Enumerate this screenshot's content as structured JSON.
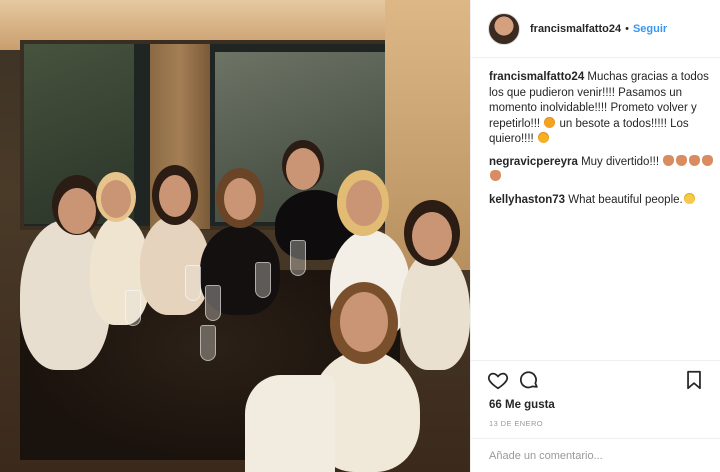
{
  "header": {
    "username": "francismalfatto24",
    "separator": "•",
    "follow_label": "Seguir"
  },
  "caption": {
    "user": "francismalfatto24",
    "text_a": " Muchas gracias a todos los que pudieron venir!!!! Pasamos un momento inolvidable!!!! Prometo volver y repetirlo!!! ",
    "text_b": " un besote a todos!!!!! Los quiero!!!! "
  },
  "comments": [
    {
      "user": "negravicpereyra",
      "text": " Muy divertido!!! "
    },
    {
      "user": "kellyhaston73",
      "text": " What beautiful people."
    }
  ],
  "actions": {
    "likes": "66 Me gusta",
    "date": "13 DE ENERO"
  },
  "add_comment": {
    "placeholder": "Añade un comentario..."
  },
  "icons": {
    "like": "heart-icon",
    "comment": "comment-icon",
    "save": "bookmark-icon"
  }
}
